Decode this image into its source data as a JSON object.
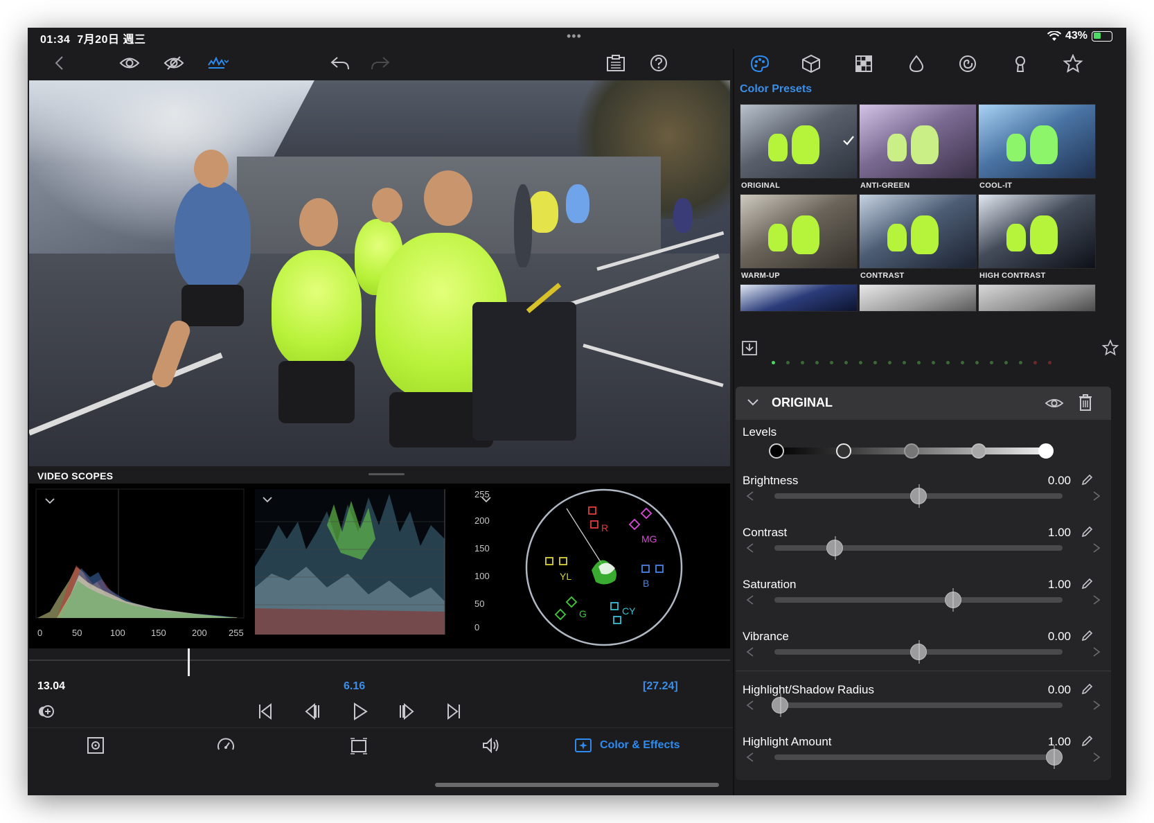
{
  "status_bar": {
    "time": "01:34",
    "date": "7月20日 週三",
    "multitask": "•••",
    "battery": "43%",
    "battery_level": 0.43,
    "wifi_icon": "wifi-icon"
  },
  "left_toolbar": {
    "icons": [
      "back-icon",
      "eye-icon",
      "eye-hidden-icon",
      "waveform-menu-icon",
      "undo-icon",
      "redo-icon",
      "clipboard-icon",
      "help-icon"
    ]
  },
  "scopes": {
    "title": "VIDEO SCOPES",
    "histogram_ticks": [
      "0",
      "50",
      "100",
      "150",
      "200",
      "255"
    ],
    "waveform_ticks": [
      "255",
      "200",
      "150",
      "100",
      "50",
      "0"
    ],
    "vectorscope_labels": [
      "R",
      "MG",
      "YL",
      "B",
      "G",
      "CY"
    ]
  },
  "timeline": {
    "current": "13.04",
    "center": "6.16",
    "duration": "[27.24]",
    "position": 0.226
  },
  "transport": [
    "skip-start-icon",
    "step-back-icon",
    "play-icon",
    "step-forward-icon",
    "skip-end-icon"
  ],
  "tabbar": {
    "active_label": "Color & Effects",
    "accent": "#2d8cf0"
  },
  "right_panel": {
    "tools": [
      "palette-icon",
      "cube-icon",
      "grid-icon",
      "drop-icon",
      "spiral-icon",
      "keyhole-icon",
      "star-icon"
    ],
    "presets_title": "Color Presets",
    "presets": [
      {
        "label": "ORIGINAL",
        "selected": true
      },
      {
        "label": "ANTI-GREEN",
        "selected": false
      },
      {
        "label": "COOL-IT",
        "selected": false
      },
      {
        "label": "WARM-UP",
        "selected": false
      },
      {
        "label": "CONTRAST",
        "selected": false
      },
      {
        "label": "HIGH CONTRAST",
        "selected": false
      }
    ],
    "adjust": {
      "title": "ORIGINAL",
      "levels_label": "Levels",
      "sliders": [
        {
          "label": "Brightness",
          "value": "0.00",
          "pos": 0.5
        },
        {
          "label": "Contrast",
          "value": "1.00",
          "pos": 0.21
        },
        {
          "label": "Saturation",
          "value": "1.00",
          "pos": 0.62
        },
        {
          "label": "Vibrance",
          "value": "0.00",
          "pos": 0.5
        },
        {
          "label": "Highlight/Shadow Radius",
          "value": "0.00",
          "pos": 0.02
        },
        {
          "label": "Highlight Amount",
          "value": "1.00",
          "pos": 0.97
        }
      ]
    }
  }
}
